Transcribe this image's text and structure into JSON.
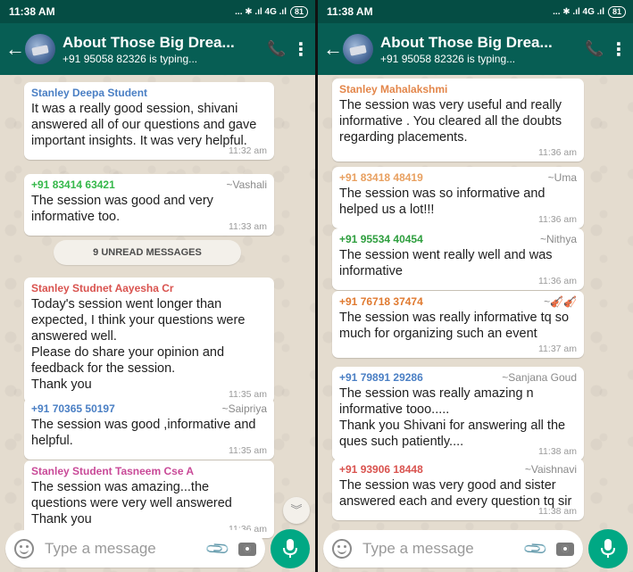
{
  "screens": [
    {
      "status_time": "11:38 AM",
      "status_icons": "... ✱ .ıl 4G .ıl",
      "battery": "81",
      "chat_title": "About Those Big Drea...",
      "chat_subtitle": "+91 95058 82326 is typing...",
      "unread_label": "9 UNREAD MESSAGES",
      "composer_placeholder": "Type a message",
      "messages": [
        {
          "sender": "Stanley Deepa Student",
          "sender_color": "#4a7fc4",
          "alias": "",
          "text": "It was a really good session, shivani answered all of our questions and gave important insights. It was very helpful.",
          "time": "11:32 am"
        },
        {
          "sender": "+91 83414 63421",
          "sender_color": "#35b84a",
          "alias": "~Vashali",
          "text": "The session was good and very informative too.",
          "time": "11:33 am"
        },
        {
          "sender": "Stanley Studnet Aayesha Cr",
          "sender_color": "#d9534f",
          "alias": "",
          "text": "Today's session went longer than expected, I think your questions were answered well.\nPlease do share your opinion and feedback for the session.\nThank you",
          "time": "11:35 am"
        },
        {
          "sender": "+91 70365 50197",
          "sender_color": "#4a7fc4",
          "alias": "~Saipriya",
          "text": "The session was good ,informative and helpful.",
          "time": "11:35 am"
        },
        {
          "sender": "Stanley Student Tasneem Cse A",
          "sender_color": "#c94a98",
          "alias": "",
          "text": "The session was amazing...the questions were very well answered\nThank you",
          "time": "11:36 am"
        }
      ]
    },
    {
      "status_time": "11:38 AM",
      "status_icons": "... ✱ .ıl 4G .ıl",
      "battery": "81",
      "chat_title": "About Those Big Drea...",
      "chat_subtitle": "+91 95058 82326 is typing...",
      "composer_placeholder": "Type a message",
      "messages": [
        {
          "sender": "Stanley Mahalakshmi",
          "sender_color": "#e3864a",
          "alias": "",
          "text": "The session was very useful and really informative . You cleared all the doubts regarding placements.",
          "time": "11:36 am"
        },
        {
          "sender": "+91 83418 48419",
          "sender_color": "#e8a060",
          "alias": "~Uma",
          "text": "The session was so informative and helped us a lot!!!",
          "time": "11:36 am"
        },
        {
          "sender": "+91 95534 40454",
          "sender_color": "#2e9e3e",
          "alias": "~Nithya",
          "text": "The session went really well and was informative",
          "time": "11:36 am"
        },
        {
          "sender": "+91 76718 37474",
          "sender_color": "#e07a30",
          "alias": "~🎻🎻",
          "text": "The session was really informative tq so much for organizing such an event",
          "time": "11:37 am"
        },
        {
          "sender": "+91 79891 29286",
          "sender_color": "#4a7fc4",
          "alias": "~Sanjana Goud",
          "text": "The session was really amazing n informative tooo.....\nThank you Shivani for answering all the ques such patiently....",
          "time": "11:38 am"
        },
        {
          "sender": "+91 93906 18448",
          "sender_color": "#d9534f",
          "alias": "~Vaishnavi",
          "text": "The session was very good and sister answered each and every question tq sir",
          "time": "11:38 am"
        }
      ]
    }
  ]
}
